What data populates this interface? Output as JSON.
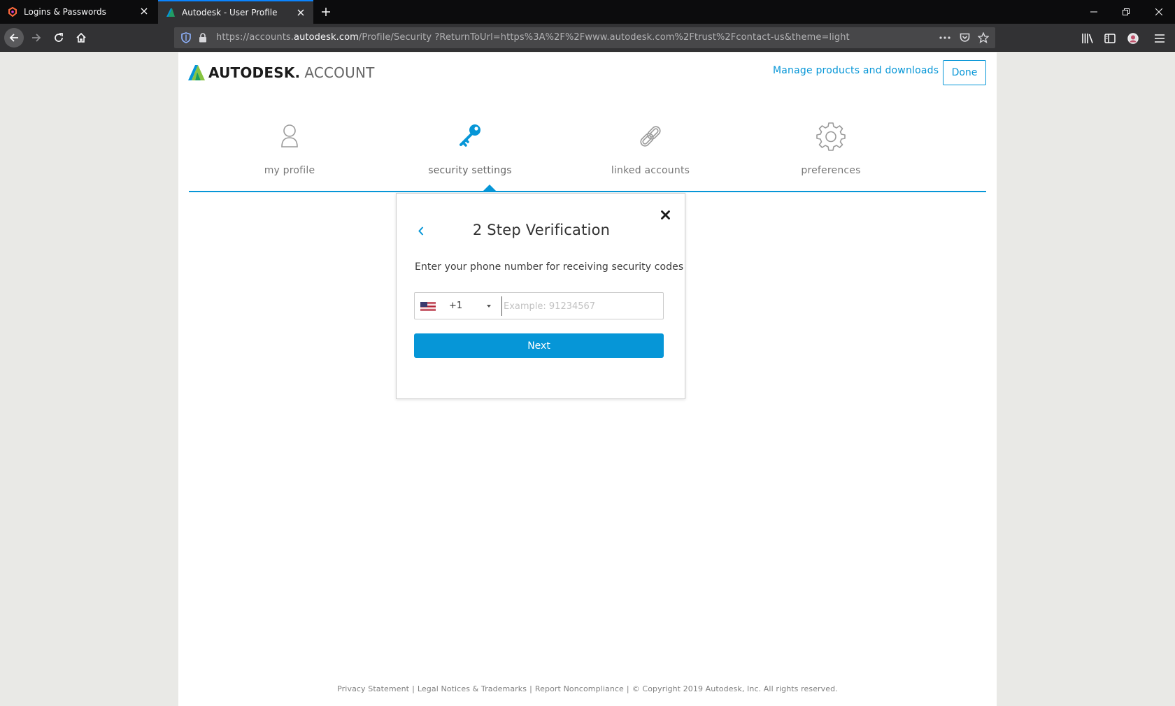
{
  "browser": {
    "tabs": [
      {
        "title": "Logins & Passwords",
        "active": false
      },
      {
        "title": "Autodesk - User Profile",
        "active": true
      }
    ],
    "url": {
      "prefix": "https://accounts.",
      "host": "autodesk.com",
      "path": "/Profile/Security ?ReturnToUrl=https%3A%2F%2Fwww.autodesk.com%2Ftrust%2Fcontact-us&theme=light"
    },
    "toolbar_icons": [
      "library-icon",
      "sidebar-icon",
      "account-avatar-icon",
      "menu-icon"
    ]
  },
  "header": {
    "brand_name": "AUTODESK.",
    "brand_suffix": "ACCOUNT",
    "manage_link": "Manage products and downloads",
    "done_label": "Done"
  },
  "nav": {
    "items": [
      {
        "label": "my profile",
        "icon": "person-icon",
        "active": false
      },
      {
        "label": "security settings",
        "icon": "key-icon",
        "active": true
      },
      {
        "label": "linked accounts",
        "icon": "link-icon",
        "active": false
      },
      {
        "label": "preferences",
        "icon": "gear-icon",
        "active": false
      }
    ]
  },
  "modal": {
    "title": "2 Step Verification",
    "description": "Enter your phone number for receiving security codes",
    "country_flag": "us-flag-icon",
    "dial_code": "+1",
    "phone_placeholder": "Example: 91234567",
    "phone_value": "",
    "next_label": "Next"
  },
  "footer": {
    "links": [
      "Privacy Statement",
      "Legal Notices & Trademarks",
      "Report Noncompliance"
    ],
    "copyright": "© Copyright 2019 Autodesk, Inc. All rights reserved."
  },
  "colors": {
    "accent": "#0696d7",
    "chrome_dark": "#0c0c0d",
    "chrome_mid": "#323234",
    "page_bg": "#e9e9e6"
  }
}
